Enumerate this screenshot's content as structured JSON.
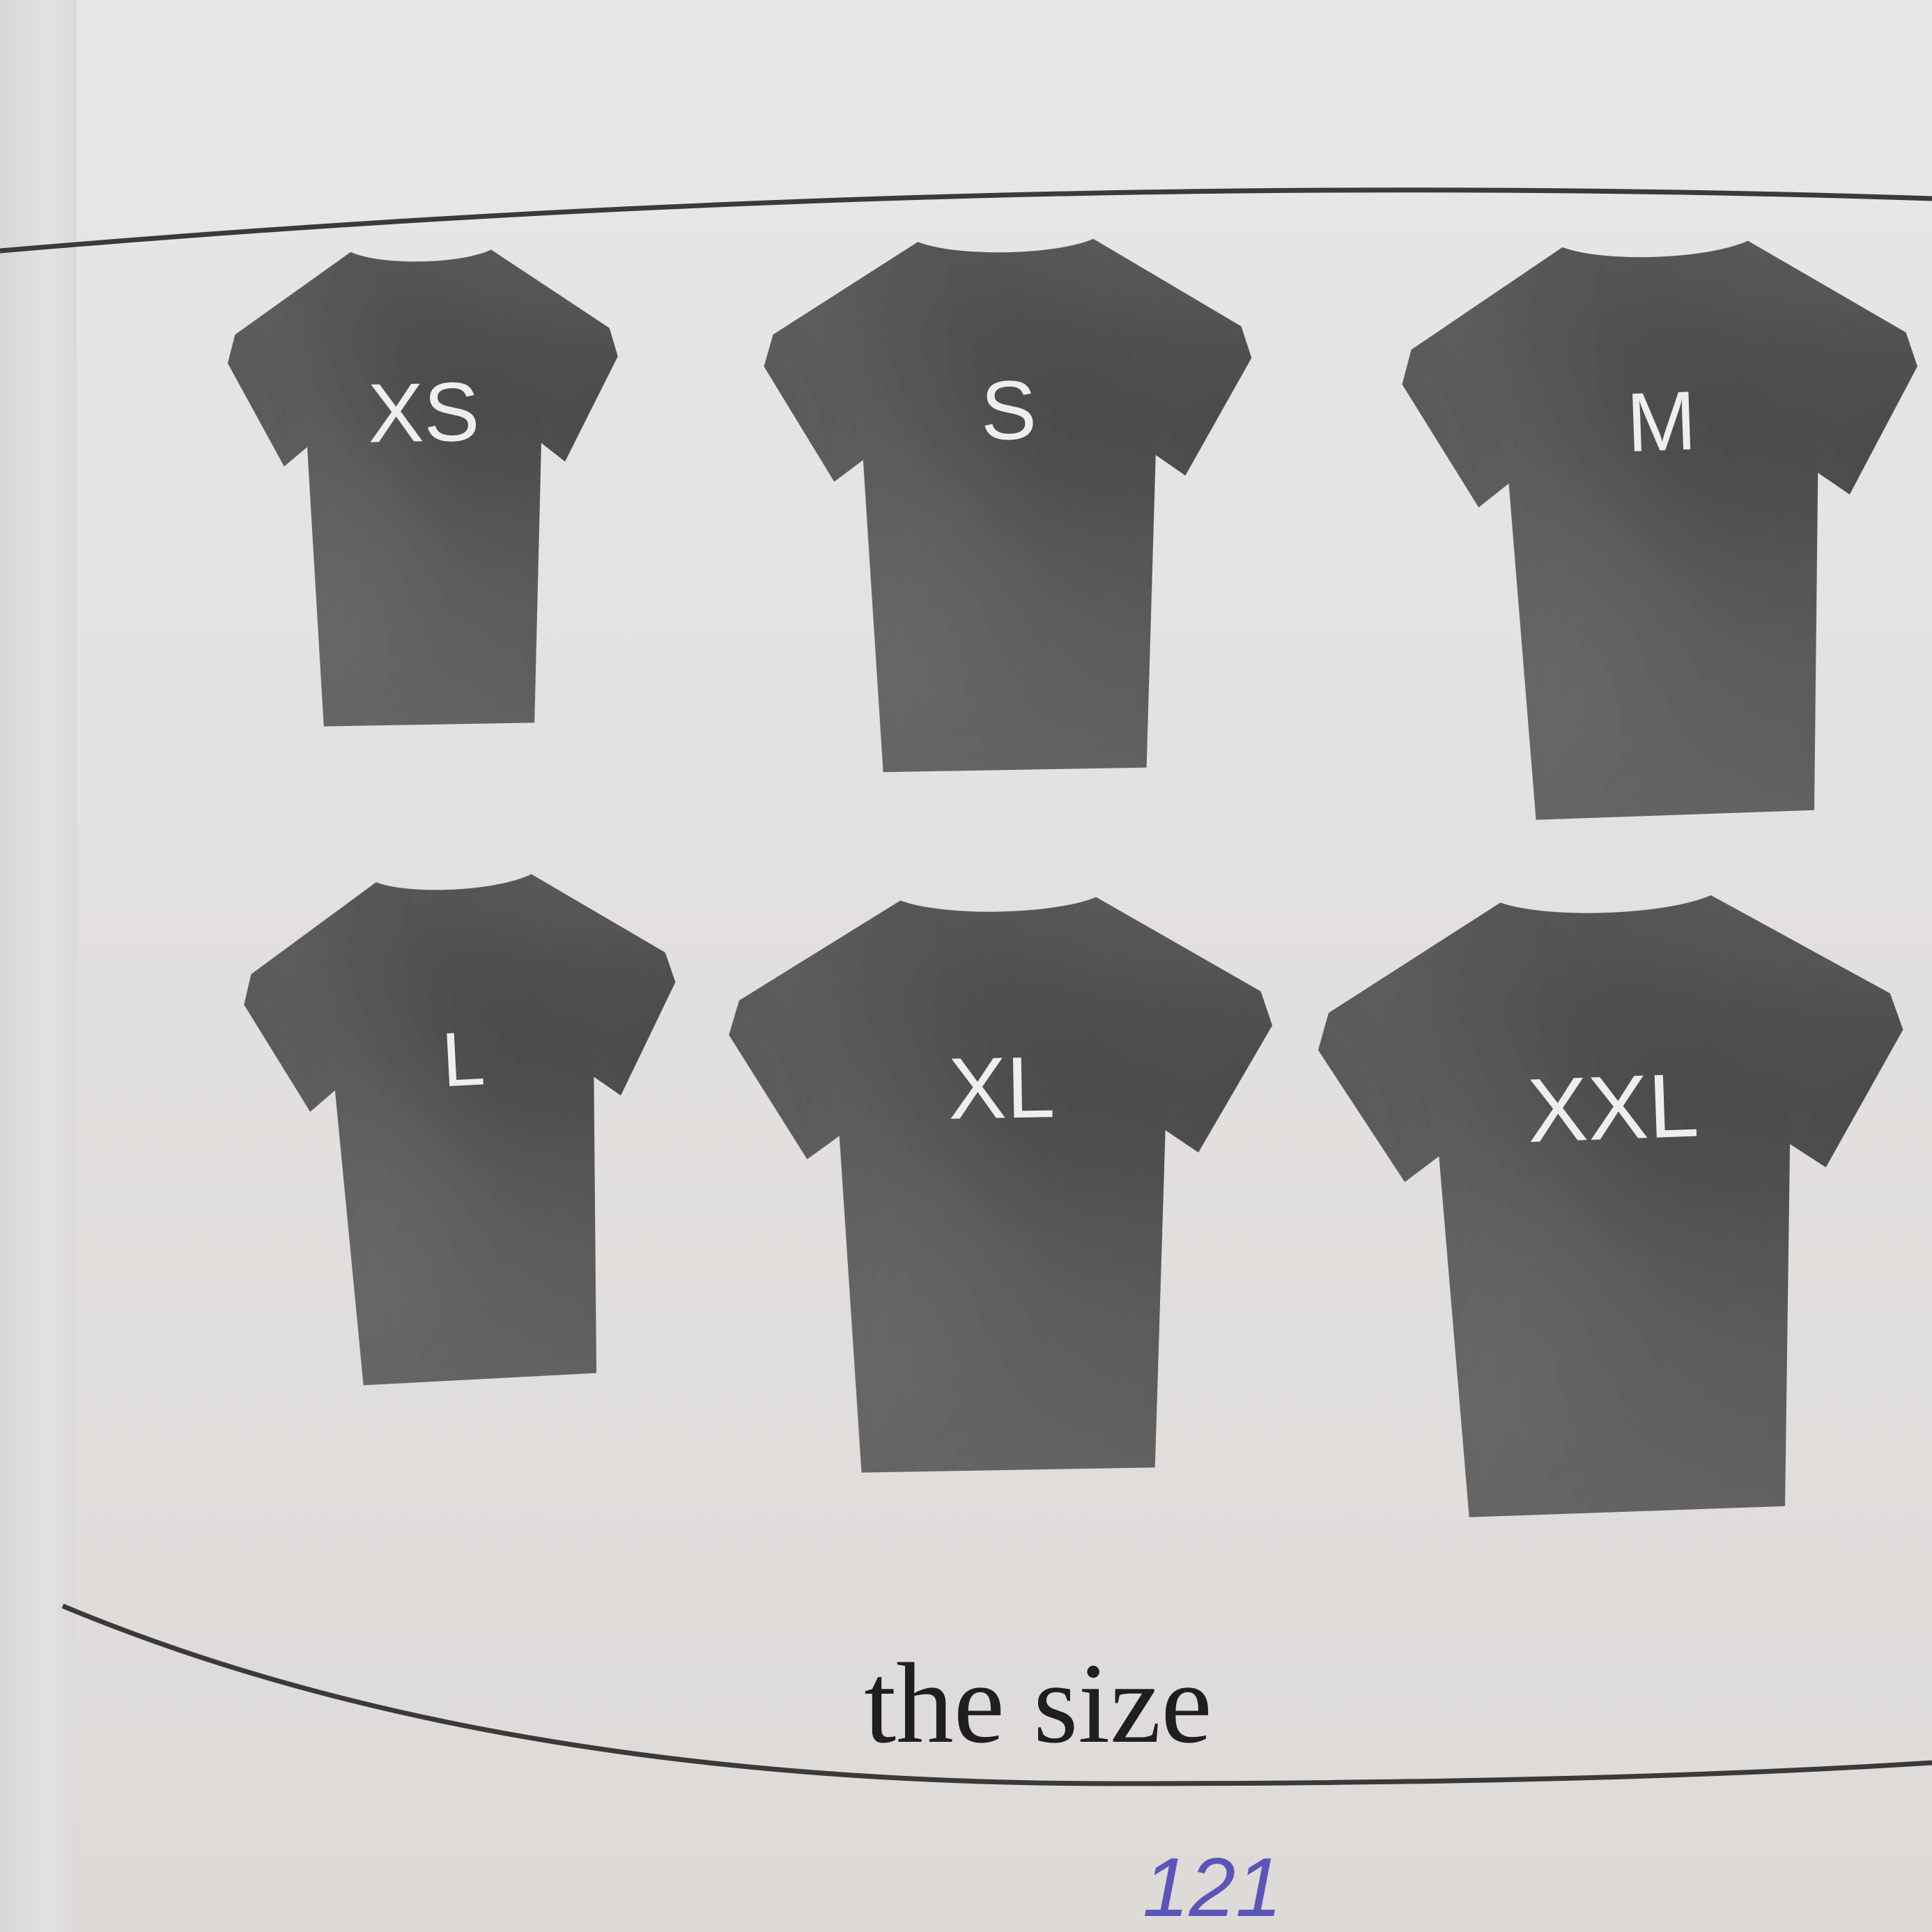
{
  "figure": {
    "shirts": [
      {
        "label": "XS"
      },
      {
        "label": "S"
      },
      {
        "label": "M"
      },
      {
        "label": "L"
      },
      {
        "label": "XL"
      },
      {
        "label": "XXL"
      }
    ],
    "caption": "the size"
  },
  "handwritten_page_number": "121",
  "colors": {
    "paper": "#e6e3e1",
    "shirt": "#2f2f2f",
    "shirt_text": "#efeeec",
    "frame_line": "#3a3a3a",
    "ink": "#5b55b8"
  }
}
